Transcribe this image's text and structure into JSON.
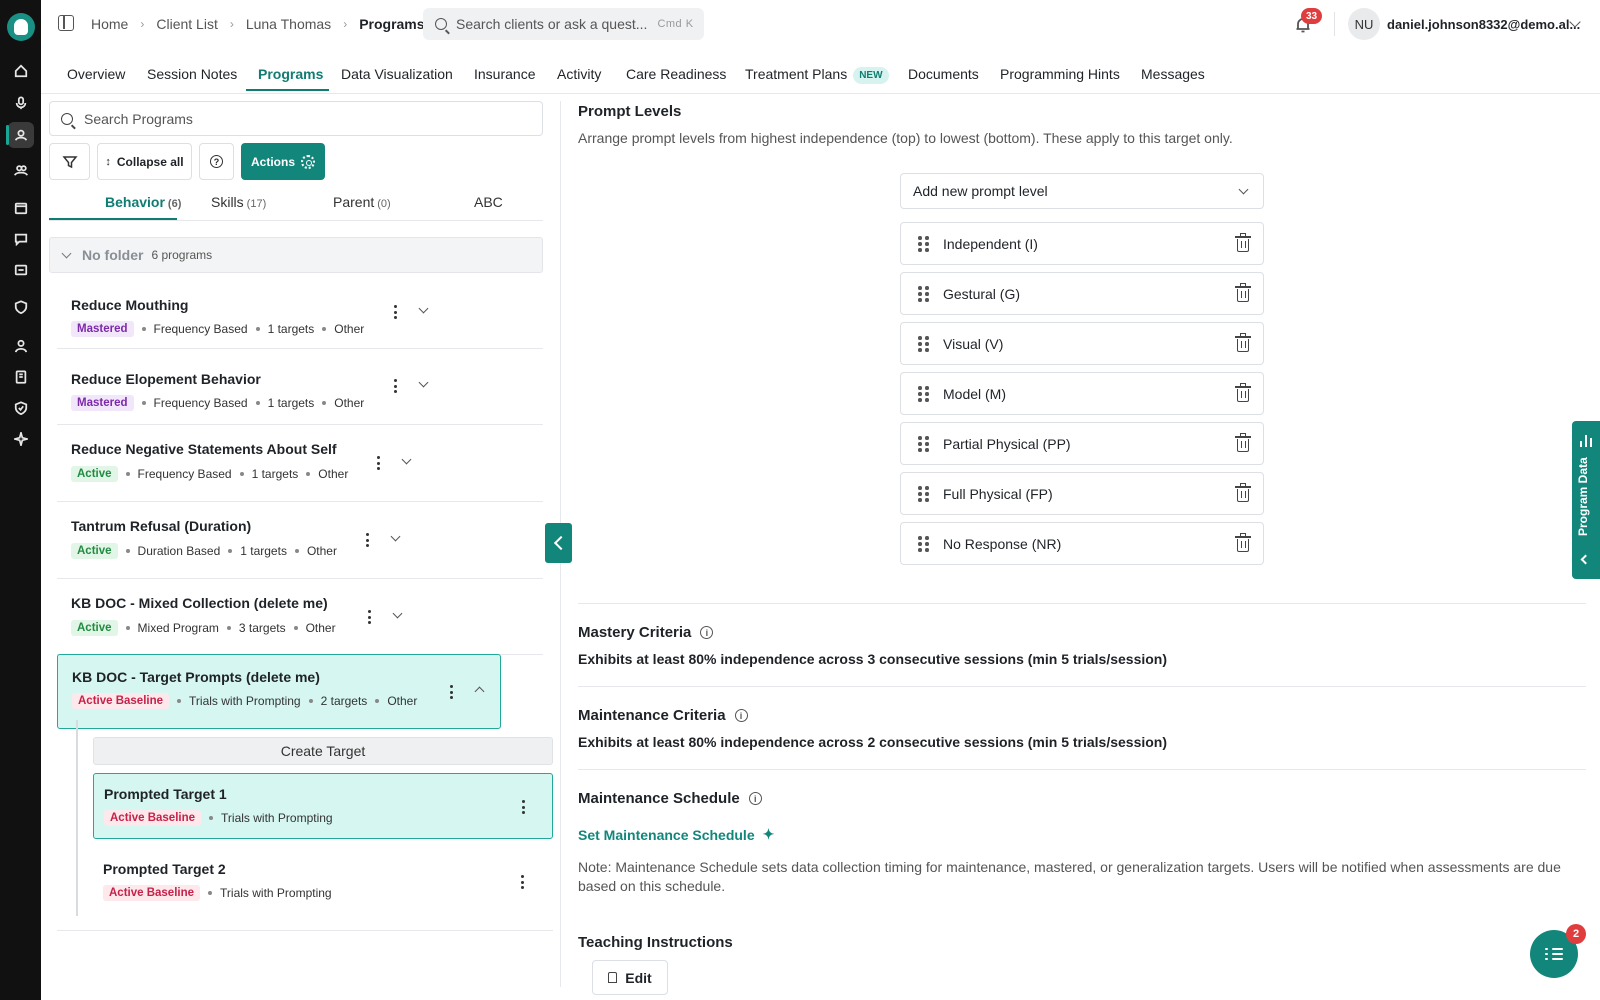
{
  "header": {
    "breadcrumbs": [
      "Home",
      "Client List",
      "Luna Thomas",
      "Programs"
    ],
    "search_placeholder": "Search clients or ask a quest...",
    "search_shortcut": "Cmd K",
    "notification_count": "33",
    "user_initials": "NU",
    "user_email": "daniel.johnson8332@demo.al..."
  },
  "tabs": [
    {
      "label": "Overview"
    },
    {
      "label": "Session Notes"
    },
    {
      "label": "Programs"
    },
    {
      "label": "Data Visualization"
    },
    {
      "label": "Insurance"
    },
    {
      "label": "Activity"
    },
    {
      "label": "Care Readiness"
    },
    {
      "label": "Treatment Plans",
      "badge": "NEW"
    },
    {
      "label": "Documents"
    },
    {
      "label": "Programming Hints"
    },
    {
      "label": "Messages"
    }
  ],
  "active_tab": "Programs",
  "left_panel": {
    "search_placeholder": "Search Programs",
    "collapse_all": "Collapse all",
    "actions": "Actions",
    "subtabs": [
      {
        "label": "Behavior",
        "count": "(6)"
      },
      {
        "label": "Skills",
        "count": "(17)"
      },
      {
        "label": "Parent",
        "count": "(0)"
      },
      {
        "label": "ABC",
        "count": ""
      }
    ],
    "folder": {
      "name": "No folder",
      "count": "6 programs"
    },
    "programs": [
      {
        "name": "Reduce Mouthing",
        "status": "Mastered",
        "type": "Frequency Based",
        "targets": "1 targets",
        "category": "Other"
      },
      {
        "name": "Reduce Elopement Behavior",
        "status": "Mastered",
        "type": "Frequency Based",
        "targets": "1 targets",
        "category": "Other"
      },
      {
        "name": "Reduce Negative Statements About Self",
        "status": "Active",
        "type": "Frequency Based",
        "targets": "1 targets",
        "category": "Other"
      },
      {
        "name": "Tantrum Refusal (Duration)",
        "status": "Active",
        "type": "Duration Based",
        "targets": "1 targets",
        "category": "Other"
      },
      {
        "name": "KB DOC - Mixed Collection (delete me)",
        "status": "Active",
        "type": "Mixed Program",
        "targets": "3 targets",
        "category": "Other"
      },
      {
        "name": "KB DOC - Target Prompts (delete me)",
        "status": "Active Baseline",
        "type": "Trials with Prompting",
        "targets": "2 targets",
        "category": "Other"
      }
    ],
    "create_target": "Create Target",
    "targets": [
      {
        "name": "Prompted Target 1",
        "status": "Active Baseline",
        "type": "Trials with Prompting"
      },
      {
        "name": "Prompted Target 2",
        "status": "Active Baseline",
        "type": "Trials with Prompting"
      }
    ]
  },
  "right_panel": {
    "prompt_levels_title": "Prompt Levels",
    "prompt_levels_desc": "Arrange prompt levels from highest independence (top) to lowest (bottom). These apply to this target only.",
    "add_prompt_level": "Add new prompt level",
    "levels": [
      "Independent (I)",
      "Gestural (G)",
      "Visual (V)",
      "Model (M)",
      "Partial Physical (PP)",
      "Full Physical (FP)",
      "No Response (NR)"
    ],
    "mastery_title": "Mastery Criteria",
    "mastery_text": "Exhibits at least 80% independence across 3 consecutive sessions (min 5 trials/session)",
    "maintenance_title": "Maintenance Criteria",
    "maintenance_text": "Exhibits at least 80% independence across 2 consecutive sessions (min 5 trials/session)",
    "schedule_title": "Maintenance Schedule",
    "set_schedule": "Set Maintenance Schedule",
    "schedule_note": "Note: Maintenance Schedule sets data collection timing for maintenance, mastered, or generalization targets. Users will be notified when assessments are due based on this schedule.",
    "teaching_title": "Teaching Instructions",
    "edit": "Edit"
  },
  "program_data_tab": "Program Data",
  "fab_badge": "2",
  "colors": {
    "accent": "#13867b",
    "badge_red": "#e03e3e"
  }
}
